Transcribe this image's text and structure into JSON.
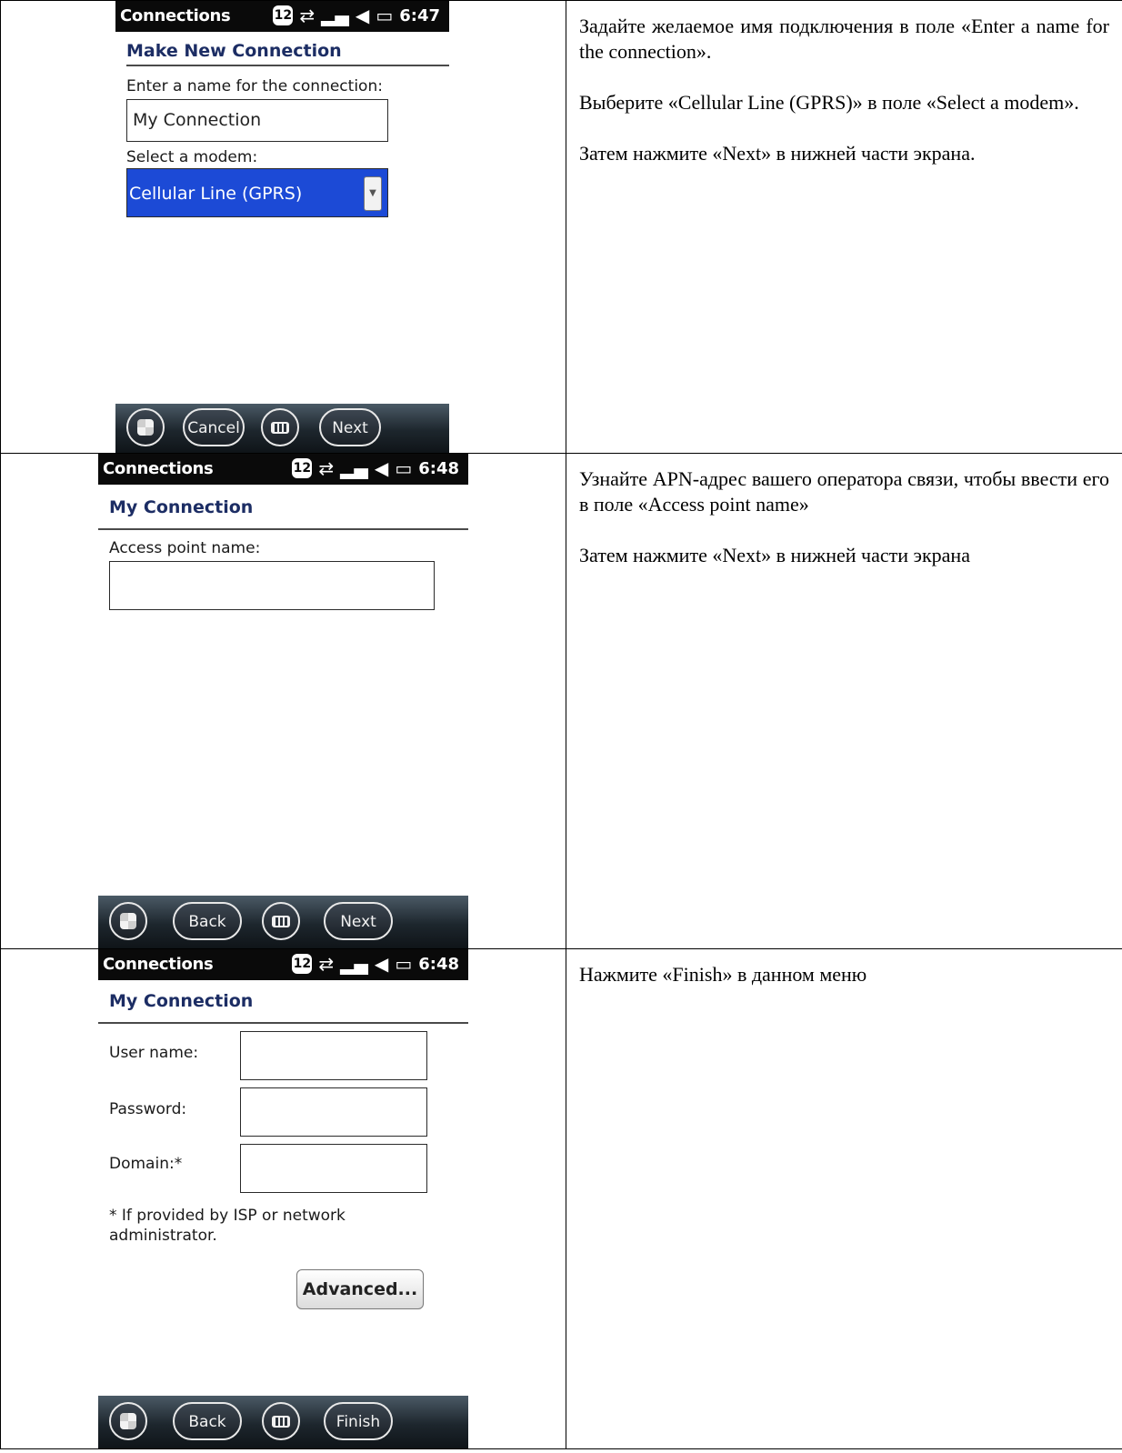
{
  "steps": [
    {
      "screen": {
        "app_name": "Connections",
        "badge": "12",
        "time": "6:47",
        "title": "Make New Connection",
        "name_label": "Enter a name for the connection:",
        "name_value": "My Connection",
        "modem_label": "Select a modem:",
        "modem_value": "Cellular Line (GPRS)",
        "softkeys": {
          "left": "Cancel",
          "right": "Next"
        }
      },
      "instructions": [
        "Задайте желаемое имя подключения в поле «Enter a name for the connection».",
        "Выберите «Cellular Line (GPRS)» в поле «Select a modem».",
        "Затем нажмите «Next» в нижней части экрана."
      ]
    },
    {
      "screen": {
        "app_name": "Connections",
        "badge": "12",
        "time": "6:48",
        "title": "My Connection",
        "apn_label": "Access point name:",
        "apn_value": "",
        "softkeys": {
          "left": "Back",
          "right": "Next"
        }
      },
      "instructions": [
        "Узнайте APN-адрес вашего оператора связи, чтобы ввести его в поле «Access point name»",
        "Затем нажмите «Next» в нижней части экрана"
      ]
    },
    {
      "screen": {
        "app_name": "Connections",
        "badge": "12",
        "time": "6:48",
        "title": "My Connection",
        "user_label": "User name:",
        "password_label": "Password:",
        "domain_label": "Domain:*",
        "note": "* If provided by ISP or network administrator.",
        "advanced_label": "Advanced...",
        "softkeys": {
          "left": "Back",
          "right": "Finish"
        }
      },
      "instructions": [
        "Нажмите «Finish» в данном меню"
      ]
    }
  ],
  "icons": [
    "start-menu-icon",
    "keyboard-icon",
    "data-sync-icon",
    "signal-icon",
    "volume-icon",
    "battery-icon"
  ]
}
